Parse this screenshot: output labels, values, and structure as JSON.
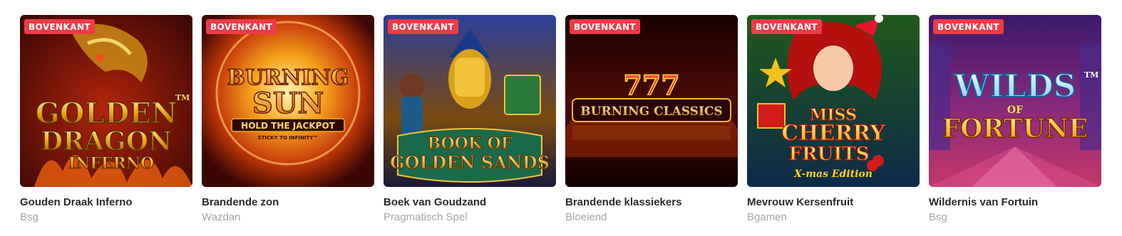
{
  "games": [
    {
      "badge": "BOVENKANT",
      "art_lines": [
        "GOLDEN",
        "DRAGON",
        "INFERNO"
      ],
      "art_tm": "TM",
      "title": "Gouden Draak Inferno",
      "provider": "Bsg",
      "colors": {
        "bg": "#5a0f07",
        "accent": "#e8a317"
      }
    },
    {
      "badge": "BOVENKANT",
      "art_lines": [
        "BURNING",
        "SUN",
        "HOLD THE JACKPOT",
        "STICKY TO INFINITY™"
      ],
      "title": "Brandende zon",
      "provider": "Wazdan",
      "colors": {
        "bg": "#7a1605",
        "accent": "#f5b21c"
      }
    },
    {
      "badge": "BOVENKANT",
      "art_lines": [
        "BOOK OF",
        "GOLDEN SANDS"
      ],
      "title": "Boek van Goudzand",
      "provider": "Pragmatisch Spel",
      "colors": {
        "bg": "#1e2a6e",
        "accent": "#f2c23a"
      }
    },
    {
      "badge": "BOVENKANT",
      "art_lines": [
        "777",
        "BURNING CLASSICS"
      ],
      "title": "Brandende klassiekers",
      "provider": "Bloeiend",
      "colors": {
        "bg": "#1a0303",
        "accent": "#f0b52a"
      }
    },
    {
      "badge": "BOVENKANT",
      "art_lines": [
        "MISS",
        "CHERRY",
        "FRUITS",
        "X-mas Edition"
      ],
      "title": "Mevrouw Kersenfruit",
      "provider": "Bgamen",
      "colors": {
        "bg": "#2d6a24",
        "accent": "#ffd11a"
      }
    },
    {
      "badge": "BOVENKANT",
      "art_lines": [
        "WILDS",
        "OF",
        "FORTUNE"
      ],
      "art_tm": "TM",
      "title": "Wildernis van Fortuin",
      "provider": "Bsg",
      "colors": {
        "bg": "#7a1f6e",
        "accent": "#ffe14a"
      }
    }
  ]
}
